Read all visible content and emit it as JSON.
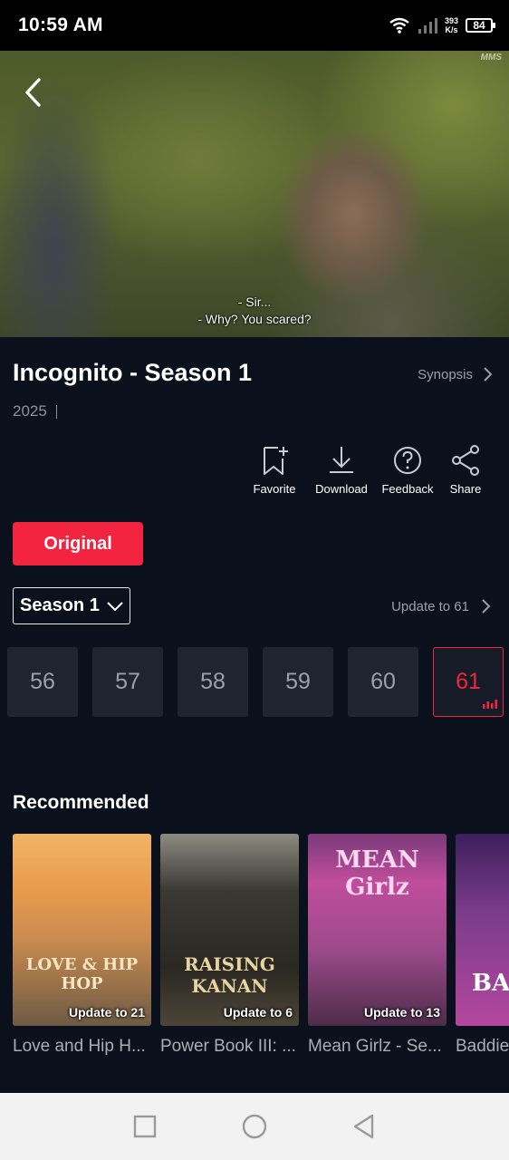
{
  "status_bar": {
    "time": "10:59 AM",
    "net_speed": "393",
    "net_unit": "K/s",
    "battery": "84"
  },
  "video": {
    "watermark": "MMS",
    "subtitle_line1": "- Sir...",
    "subtitle_line2": "- Why? You scared?"
  },
  "show": {
    "title": "Incognito - Season 1",
    "synopsis_label": "Synopsis",
    "year": "2025"
  },
  "actions": [
    {
      "label": "Favorite",
      "icon": "bookmark-add-icon"
    },
    {
      "label": "Download",
      "icon": "download-icon"
    },
    {
      "label": "Feedback",
      "icon": "help-icon"
    },
    {
      "label": "Share",
      "icon": "share-icon"
    }
  ],
  "original_label": "Original",
  "season": {
    "selected": "Season 1",
    "update_label": "Update to 61"
  },
  "episodes": [
    "56",
    "57",
    "58",
    "59",
    "60",
    "61"
  ],
  "active_episode": "61",
  "recommended": {
    "title": "Recommended",
    "items": [
      {
        "name": "Love and Hip H...",
        "badge": "Update to 21",
        "art": "LOVE & HIP HOP"
      },
      {
        "name": "Power Book III: ...",
        "badge": "Update to 6",
        "art": "RAISING KANAN"
      },
      {
        "name": "Mean Girlz - Se...",
        "badge": "Update to 13",
        "art": "MEAN Girlz"
      },
      {
        "name": "Baddie",
        "badge": "",
        "art": "BA"
      }
    ]
  },
  "colors": {
    "accent": "#f3243f",
    "background": "#0b111c"
  }
}
